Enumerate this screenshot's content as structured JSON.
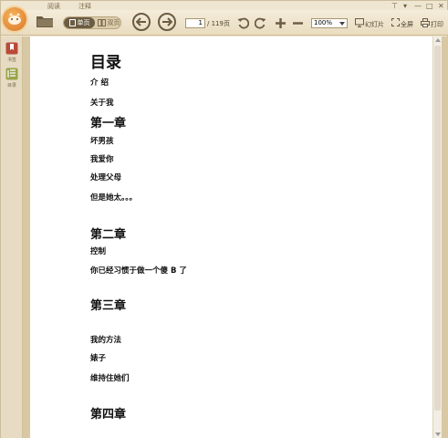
{
  "menu": {
    "tabs": [
      "阅读",
      "注释"
    ]
  },
  "window_controls": {
    "pin": "⊤",
    "dropdown": "▾",
    "minimize": "—",
    "maximize": "□",
    "close": "✕"
  },
  "toolbar": {
    "view_single": "单页",
    "view_double": "双页",
    "current_page": "1",
    "page_count": "/ 119页",
    "zoom": "100%",
    "slideshow": "幻灯片",
    "fullscreen": "全屏",
    "print": "打印"
  },
  "sidebar": {
    "items": [
      {
        "label": "书签",
        "icon": "bookmark-icon"
      },
      {
        "label": "目录",
        "icon": "toc-icon"
      }
    ]
  },
  "document": {
    "title": "目录",
    "entries": {
      "intro": "介 绍",
      "about": "关于我",
      "ch1": "第一章",
      "ch1_1": "坏男孩",
      "ch1_2": "我爱你",
      "ch1_3": "处理父母",
      "ch1_4": "但是她太。。。",
      "ch2": "第二章",
      "ch2_1": "控制",
      "ch2_2": "你已经习惯于做一个傻 B 了",
      "ch3": "第三章",
      "ch3_1": "我的方法",
      "ch3_2": "婊子",
      "ch3_3": "维持住她们",
      "ch4": "第四章"
    }
  },
  "colors": {
    "accent": "#d9782a",
    "toolbar_bg": "#efe6d1",
    "page_bg": "#ffffff",
    "sidebar_bg": "#e7dcc3"
  }
}
